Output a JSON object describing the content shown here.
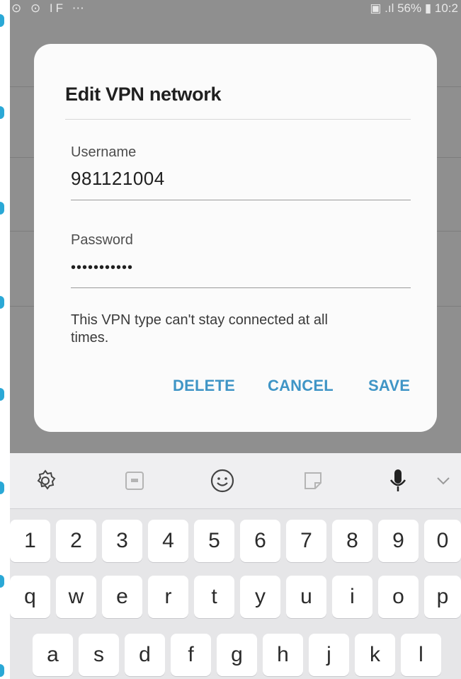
{
  "status_bar": {
    "left": "⊙ ⊙ IF ⋯",
    "right": "▣ .ıl 56% ▮ 10:2"
  },
  "dialog": {
    "title": "Edit VPN network",
    "username_label": "Username",
    "username_value": "981121004",
    "password_label": "Password",
    "password_value": "•••••••••••",
    "info_text": "This VPN type can't stay connected at all times.",
    "buttons": {
      "delete": "DELETE",
      "cancel": "CANCEL",
      "save": "SAVE"
    }
  },
  "keyboard_toolbar": {
    "icons": [
      "gear-icon",
      "gif-icon",
      "emoji-icon",
      "sticker-icon",
      "microphone-icon",
      "chevron-down-icon"
    ]
  },
  "keyboard": {
    "row1": [
      "1",
      "2",
      "3",
      "4",
      "5",
      "6",
      "7",
      "8",
      "9",
      "0"
    ],
    "row2": [
      "q",
      "w",
      "e",
      "r",
      "t",
      "y",
      "u",
      "i",
      "o",
      "p"
    ],
    "row3": [
      "a",
      "s",
      "d",
      "f",
      "g",
      "h",
      "j",
      "k",
      "l"
    ]
  },
  "colors": {
    "accent": "#3f95c6",
    "dim_background": "#8f8f8f",
    "dialog_bg": "#fbfbfb",
    "keyboard_bg": "#e6e6e8"
  }
}
